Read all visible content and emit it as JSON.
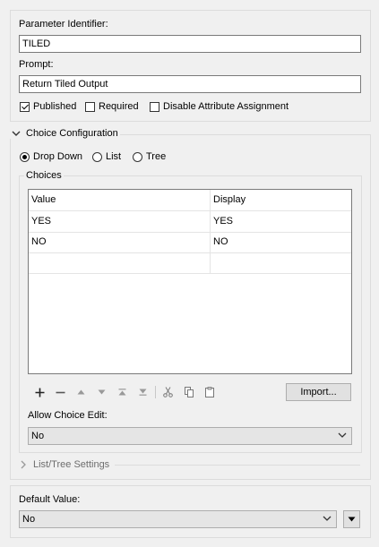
{
  "parameter": {
    "identifier_label": "Parameter Identifier:",
    "identifier_value": "TILED",
    "prompt_label": "Prompt:",
    "prompt_value": "Return Tiled Output"
  },
  "options": {
    "published_label": "Published",
    "published_checked": true,
    "required_label": "Required",
    "required_checked": false,
    "disable_attr_label": "Disable Attribute Assignment",
    "disable_attr_checked": false
  },
  "choice_config": {
    "title": "Choice Configuration",
    "radio_dropdown": "Drop Down",
    "radio_list": "List",
    "radio_tree": "Tree",
    "selected": "Drop Down"
  },
  "choices": {
    "title": "Choices",
    "columns": [
      "Value",
      "Display"
    ],
    "rows": [
      {
        "value": "YES",
        "display": "YES"
      },
      {
        "value": "NO",
        "display": "NO"
      }
    ],
    "import_label": "Import...",
    "allow_edit_label": "Allow Choice Edit:",
    "allow_edit_value": "No"
  },
  "list_tree": {
    "title": "List/Tree Settings"
  },
  "default": {
    "label": "Default Value:",
    "value": "No"
  },
  "colors": {
    "border": "#dcdcdc",
    "field_border": "#7a7a7a",
    "disabled_text": "#6d6d6d"
  }
}
